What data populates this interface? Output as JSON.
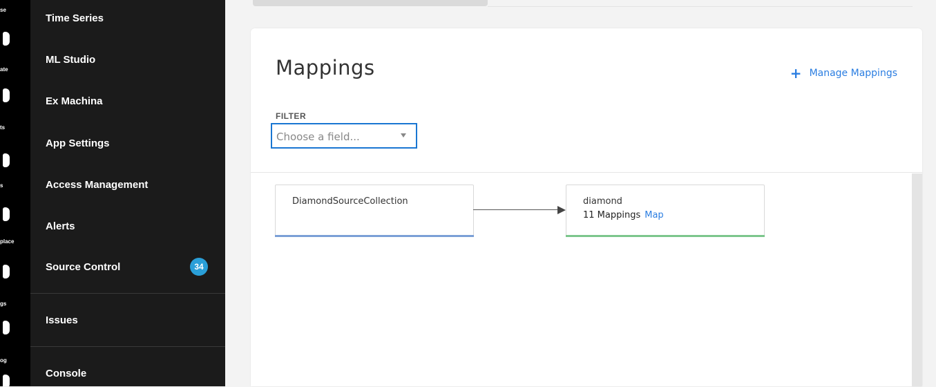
{
  "rail": {
    "labels": [
      "se",
      "ate",
      "ts",
      "s",
      "place",
      "gs",
      "og"
    ]
  },
  "sidebar": {
    "items": [
      {
        "label": "Time Series"
      },
      {
        "label": "ML Studio"
      },
      {
        "label": "Ex Machina"
      },
      {
        "label": "App Settings"
      },
      {
        "label": "Access Management"
      },
      {
        "label": "Alerts"
      },
      {
        "label": "Source Control",
        "badge": "34"
      },
      {
        "label": "Issues"
      },
      {
        "label": "Console"
      }
    ]
  },
  "main": {
    "title": "Mappings",
    "manage_label": "Manage Mappings",
    "filter": {
      "label": "FILTER",
      "placeholder": "Choose a field..."
    }
  },
  "graph": {
    "source": {
      "title": "DiamondSourceCollection",
      "bar_color": "#7b9fd6"
    },
    "target": {
      "title": "diamond",
      "mappings": "11 Mappings",
      "map_link": "Map",
      "bar_color": "#7cc68c"
    }
  },
  "colors": {
    "accent": "#2a7de1",
    "badge": "#2a9fd8",
    "sidebar_bg": "#1b1b1b"
  }
}
